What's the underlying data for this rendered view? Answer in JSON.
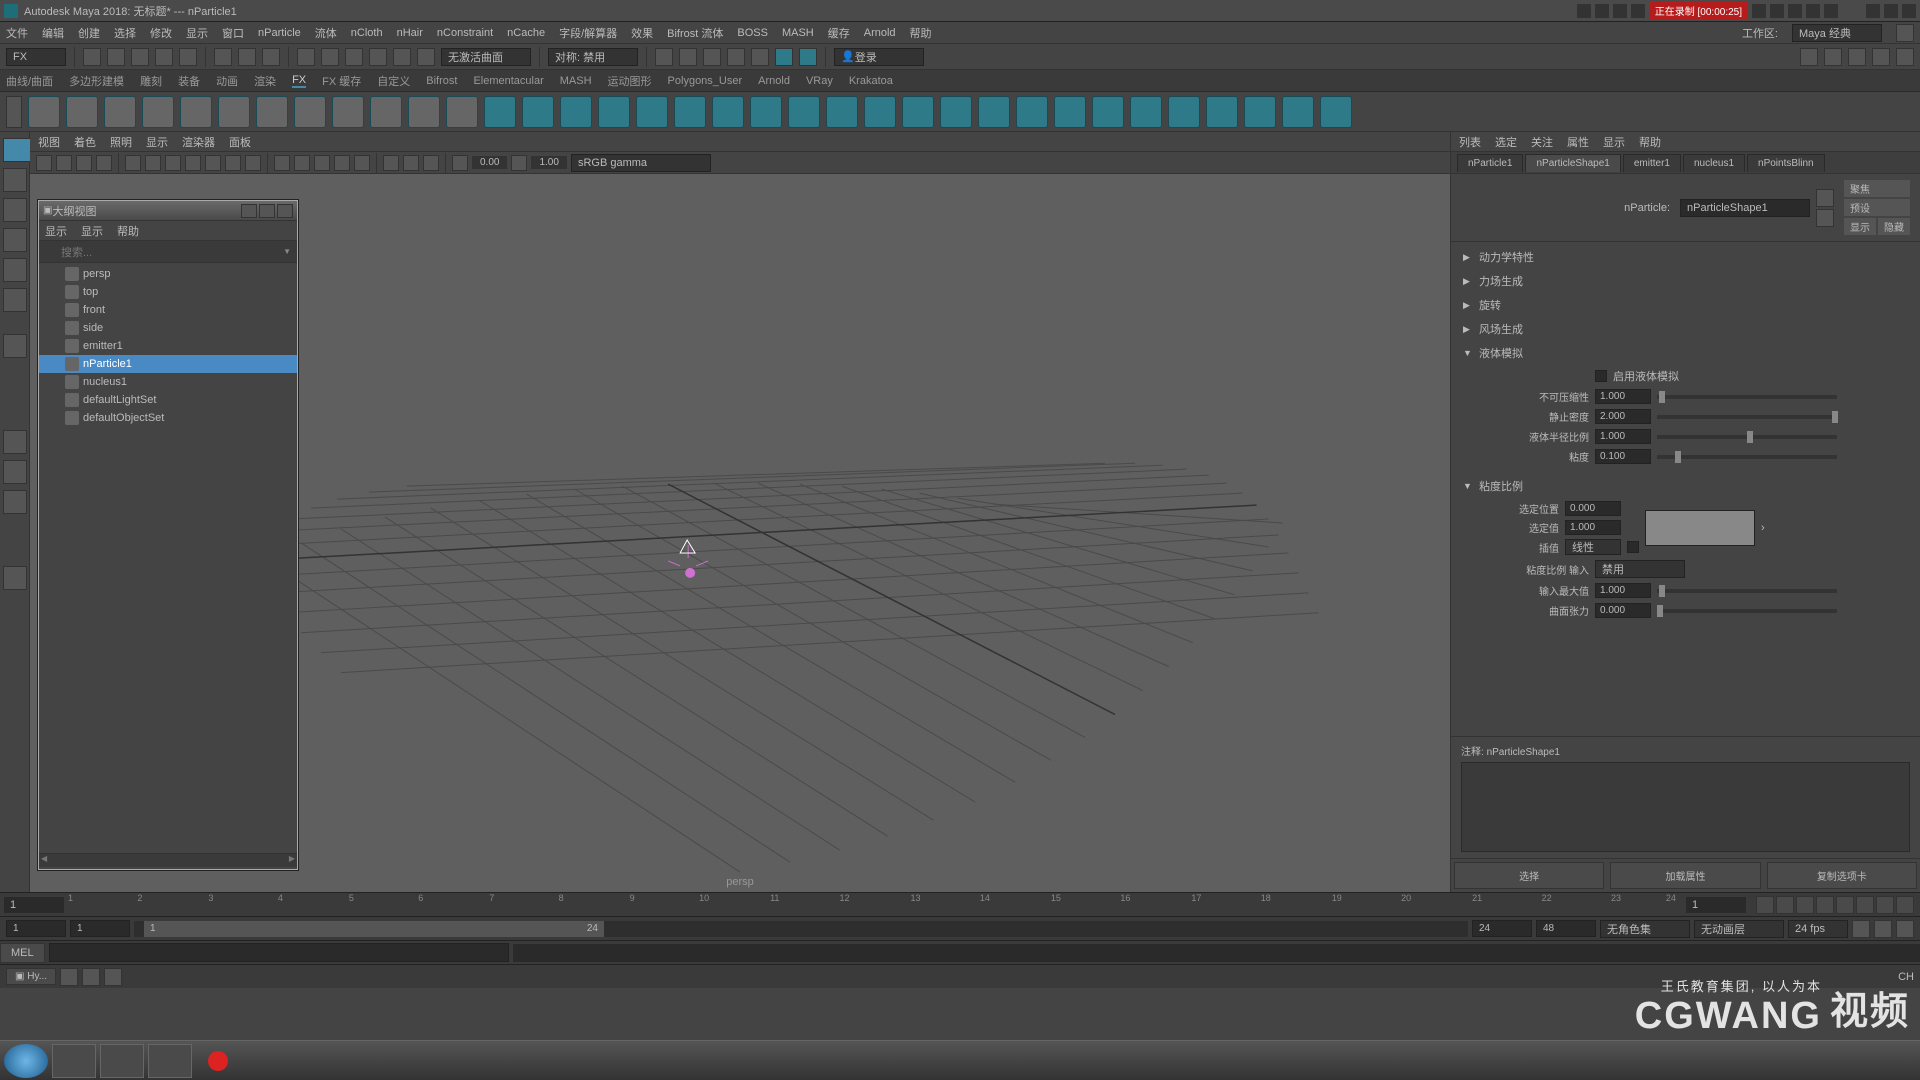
{
  "title": "Autodesk Maya 2018: 无标题*  ---  nParticle1",
  "recording": "正在录制 [00:00:25]",
  "workspace_label": "工作区:",
  "workspace_value": "Maya 经典",
  "menus": [
    "文件",
    "编辑",
    "创建",
    "选择",
    "修改",
    "显示",
    "窗口",
    "nParticle",
    "流体",
    "nCloth",
    "nHair",
    "nConstraint",
    "nCache",
    "字段/解算器",
    "效果",
    "Bifrost 流体",
    "BOSS",
    "MASH",
    "缓存",
    "Arnold",
    "帮助"
  ],
  "module_dropdown": "FX",
  "no_active_surface": "无激活曲面",
  "symmetry": "对称: 禁用",
  "login": "登录",
  "shelf_tabs": [
    "曲线/曲面",
    "多边形建模",
    "雕刻",
    "装备",
    "动画",
    "渲染",
    "FX",
    "FX 缓存",
    "自定义",
    "Bifrost",
    "Elementacular",
    "MASH",
    "运动图形",
    "Polygons_User",
    "Arnold",
    "VRay",
    "Krakatoa"
  ],
  "shelf_active": "FX",
  "vp_menus": [
    "视图",
    "着色",
    "照明",
    "显示",
    "渲染器",
    "面板"
  ],
  "vp_gamma_val1": "0.00",
  "vp_gamma_val2": "1.00",
  "vp_colorspace": "sRGB gamma",
  "vp_camera": "persp",
  "outliner": {
    "title": "大纲视图",
    "menus": [
      "显示",
      "显示",
      "帮助"
    ],
    "search_placeholder": "搜索...",
    "items": [
      {
        "name": "persp",
        "level": 1
      },
      {
        "name": "top",
        "level": 1
      },
      {
        "name": "front",
        "level": 1
      },
      {
        "name": "side",
        "level": 1
      },
      {
        "name": "emitter1",
        "level": 1
      },
      {
        "name": "nParticle1",
        "level": 1,
        "selected": true
      },
      {
        "name": "nucleus1",
        "level": 1
      },
      {
        "name": "defaultLightSet",
        "level": 1
      },
      {
        "name": "defaultObjectSet",
        "level": 1
      }
    ]
  },
  "attr_top": [
    "列表",
    "选定",
    "关注",
    "属性",
    "显示",
    "帮助"
  ],
  "attr_tabs": [
    "nParticle1",
    "nParticleShape1",
    "emitter1",
    "nucleus1",
    "nPointsBlinn"
  ],
  "attr_tab_active": "nParticleShape1",
  "node_label": "nParticle:",
  "node_name": "nParticleShape1",
  "side_btns": [
    "聚焦",
    "预设",
    "显示",
    "隐藏"
  ],
  "sections_collapsed": [
    "动力学特性",
    "力场生成",
    "旋转",
    "风场生成"
  ],
  "liquid_sim": "液体模拟",
  "enable_liquid": "启用液体模拟",
  "incompressibility_lbl": "不可压缩性",
  "incompressibility_val": "1.000",
  "rest_density_lbl": "静止密度",
  "rest_density_val": "2.000",
  "radius_scale_lbl": "液体半径比例",
  "radius_scale_val": "1.000",
  "viscosity_lbl": "粘度",
  "viscosity_val": "0.100",
  "viscosity_scale": "粘度比例",
  "sel_pos_lbl": "选定位置",
  "sel_pos_val": "0.000",
  "sel_val_lbl": "选定值",
  "sel_val_val": "1.000",
  "interp_lbl": "插值",
  "interp_val": "线性",
  "visc_input_lbl": "粘度比例 输入",
  "visc_input_val": "禁用",
  "input_max_lbl": "输入最大值",
  "input_max_val": "1.000",
  "surface_tension_lbl": "曲面张力",
  "surface_tension_val": "0.000",
  "notes_lbl": "注释:",
  "notes_name": "nParticleShape1",
  "attr_foot": [
    "选择",
    "加载属性",
    "复制选项卡"
  ],
  "timeline": {
    "current": "1",
    "ticks": [
      "1",
      "2",
      "3",
      "4",
      "5",
      "6",
      "7",
      "8",
      "9",
      "10",
      "11",
      "12",
      "13",
      "14",
      "15",
      "16",
      "17",
      "18",
      "19",
      "20",
      "21",
      "22",
      "23",
      "24"
    ],
    "cur_right": "1"
  },
  "range": {
    "start_out": "1",
    "start_in": "1",
    "end_in": "24",
    "end_out": "24",
    "playback": "48",
    "colorset": "无角色集",
    "anim_layer": "无动画层",
    "fps": "24 fps"
  },
  "cmd_label": "MEL",
  "help_tab": "Hy...",
  "status_ch": "CH",
  "watermark_main": "CGWANG",
  "watermark_sub": "王氏教育集团, 以人为本",
  "watermark_vid": "视频"
}
